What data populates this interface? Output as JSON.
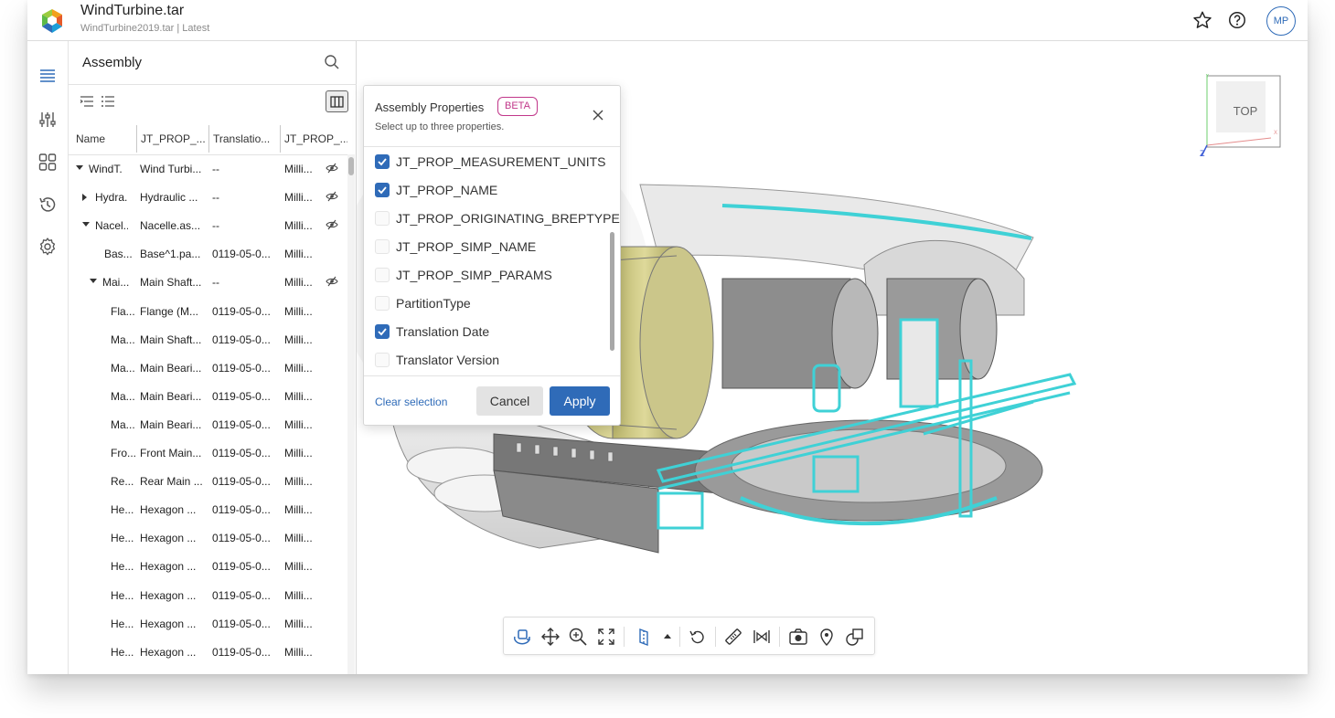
{
  "header": {
    "title": "WindTurbine.tar",
    "subtitle": "WindTurbine2019.tar | Latest",
    "avatar": "MP"
  },
  "assembly": {
    "title": "Assembly",
    "columns": [
      "Name",
      "JT_PROP_...",
      "Translatio...",
      "JT_PROP_..."
    ],
    "rows": [
      {
        "name": "WindT...",
        "prop": "Wind Turbi...",
        "date": "--",
        "units": "Milli...",
        "indent": 0,
        "caret": "down",
        "eye": true
      },
      {
        "name": "Hydra...",
        "prop": "Hydraulic ...",
        "date": "--",
        "units": "Milli...",
        "indent": 1,
        "caret": "right",
        "eye": true
      },
      {
        "name": "Nacel...",
        "prop": "Nacelle.as...",
        "date": "--",
        "units": "Milli...",
        "indent": 1,
        "caret": "down",
        "eye": true
      },
      {
        "name": "Bas...",
        "prop": "Base^1.pa...",
        "date": "0119-05-0...",
        "units": "Milli...",
        "indent": 2,
        "caret": "",
        "eye": false
      },
      {
        "name": "Mai...",
        "prop": "Main Shaft...",
        "date": "--",
        "units": "Milli...",
        "indent": 2,
        "caret": "down",
        "eye": true
      },
      {
        "name": "Fla...",
        "prop": "Flange (M...",
        "date": "0119-05-0...",
        "units": "Milli...",
        "indent": 3,
        "caret": "",
        "eye": false
      },
      {
        "name": "Ma...",
        "prop": "Main Shaft...",
        "date": "0119-05-0...",
        "units": "Milli...",
        "indent": 3,
        "caret": "",
        "eye": false
      },
      {
        "name": "Ma...",
        "prop": "Main Beari...",
        "date": "0119-05-0...",
        "units": "Milli...",
        "indent": 3,
        "caret": "",
        "eye": false
      },
      {
        "name": "Ma...",
        "prop": "Main Beari...",
        "date": "0119-05-0...",
        "units": "Milli...",
        "indent": 3,
        "caret": "",
        "eye": false
      },
      {
        "name": "Ma...",
        "prop": "Main Beari...",
        "date": "0119-05-0...",
        "units": "Milli...",
        "indent": 3,
        "caret": "",
        "eye": false
      },
      {
        "name": "Fro...",
        "prop": "Front Main...",
        "date": "0119-05-0...",
        "units": "Milli...",
        "indent": 3,
        "caret": "",
        "eye": false
      },
      {
        "name": "Re...",
        "prop": "Rear Main ...",
        "date": "0119-05-0...",
        "units": "Milli...",
        "indent": 3,
        "caret": "",
        "eye": false
      },
      {
        "name": "He...",
        "prop": "Hexagon ...",
        "date": "0119-05-0...",
        "units": "Milli...",
        "indent": 3,
        "caret": "",
        "eye": false
      },
      {
        "name": "He...",
        "prop": "Hexagon ...",
        "date": "0119-05-0...",
        "units": "Milli...",
        "indent": 3,
        "caret": "",
        "eye": false
      },
      {
        "name": "He...",
        "prop": "Hexagon ...",
        "date": "0119-05-0...",
        "units": "Milli...",
        "indent": 3,
        "caret": "",
        "eye": false
      },
      {
        "name": "He...",
        "prop": "Hexagon ...",
        "date": "0119-05-0...",
        "units": "Milli...",
        "indent": 3,
        "caret": "",
        "eye": false
      },
      {
        "name": "He...",
        "prop": "Hexagon ...",
        "date": "0119-05-0...",
        "units": "Milli...",
        "indent": 3,
        "caret": "",
        "eye": false
      },
      {
        "name": "He...",
        "prop": "Hexagon ...",
        "date": "0119-05-0...",
        "units": "Milli...",
        "indent": 3,
        "caret": "",
        "eye": false
      }
    ]
  },
  "dialog": {
    "title": "Assembly Properties",
    "badge": "BETA",
    "subtitle": "Select up to three properties.",
    "options": [
      {
        "label": "JT_PROP_MEASUREMENT_UNITS",
        "checked": true
      },
      {
        "label": "JT_PROP_NAME",
        "checked": true
      },
      {
        "label": "JT_PROP_ORIGINATING_BREPTYPE",
        "checked": false
      },
      {
        "label": "JT_PROP_SIMP_NAME",
        "checked": false
      },
      {
        "label": "JT_PROP_SIMP_PARAMS",
        "checked": false
      },
      {
        "label": "PartitionType",
        "checked": false
      },
      {
        "label": "Translation Date",
        "checked": true
      },
      {
        "label": "Translator Version",
        "checked": false
      }
    ],
    "clear_label": "Clear selection",
    "cancel_label": "Cancel",
    "apply_label": "Apply"
  },
  "viewcube": {
    "face_label": "TOP",
    "axis_y": "Y",
    "axis_z": "Z",
    "axis_x": "X"
  },
  "toolbar": {
    "buttons": [
      "orbit-icon",
      "pan-icon",
      "zoom-icon",
      "fit-icon",
      "section-icon",
      "expand-up-icon",
      "reset-icon",
      "measure-icon",
      "explode-icon",
      "snapshot-icon",
      "markup-pin-icon",
      "shapes-icon"
    ]
  },
  "colors": {
    "accent": "#2f6bb8",
    "beta": "#c1378a",
    "highlight": "#3fd1d6"
  }
}
